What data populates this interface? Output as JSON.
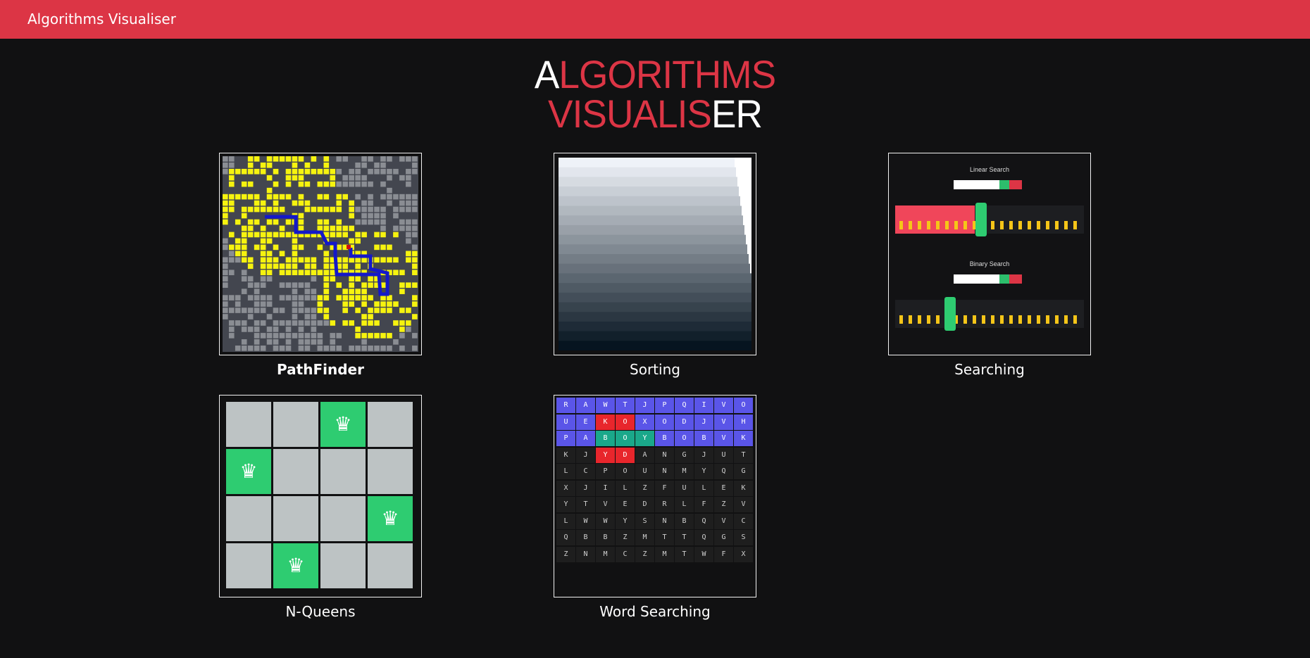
{
  "navbar": {
    "brand": "Algorithms Visualiser",
    "color": "#dc3545"
  },
  "hero": {
    "line1": "ALGORITHMS",
    "line2": "VISUALISER"
  },
  "cards": [
    {
      "label": "PathFinder"
    },
    {
      "label": "Sorting"
    },
    {
      "label": "Searching"
    },
    {
      "label": "N-Queens"
    },
    {
      "label": "Word Searching"
    }
  ],
  "searching_preview": {
    "linear_title": "Linear Search",
    "binary_title": "Binary Search"
  },
  "nqueens_preview": {
    "size": 4,
    "queens": [
      [
        0,
        2
      ],
      [
        1,
        0
      ],
      [
        2,
        3
      ],
      [
        3,
        1
      ]
    ],
    "queen_glyph": "♛"
  },
  "wordsearch_preview": {
    "grid": [
      "RAWTJPQIVO",
      "UEKOXODJVH",
      "PABOYBOBVK",
      "KJYDANGJUT",
      "LCPOUNMYQG",
      "XJILZFULEK",
      "YTVEDRLFZV",
      "LWWYSNBQVC",
      "QBBZMTTQGS",
      "ZNMCZMTWFX"
    ],
    "blue_rows": 3,
    "red_cells": [
      [
        1,
        2
      ],
      [
        1,
        3
      ],
      [
        3,
        2
      ],
      [
        3,
        3
      ]
    ],
    "green_cells": [
      [
        2,
        2
      ],
      [
        2,
        3
      ],
      [
        2,
        4
      ]
    ],
    "colors": {
      "blue": "#5a55e8",
      "red": "#e8262c",
      "green": "#1aa88a"
    }
  }
}
